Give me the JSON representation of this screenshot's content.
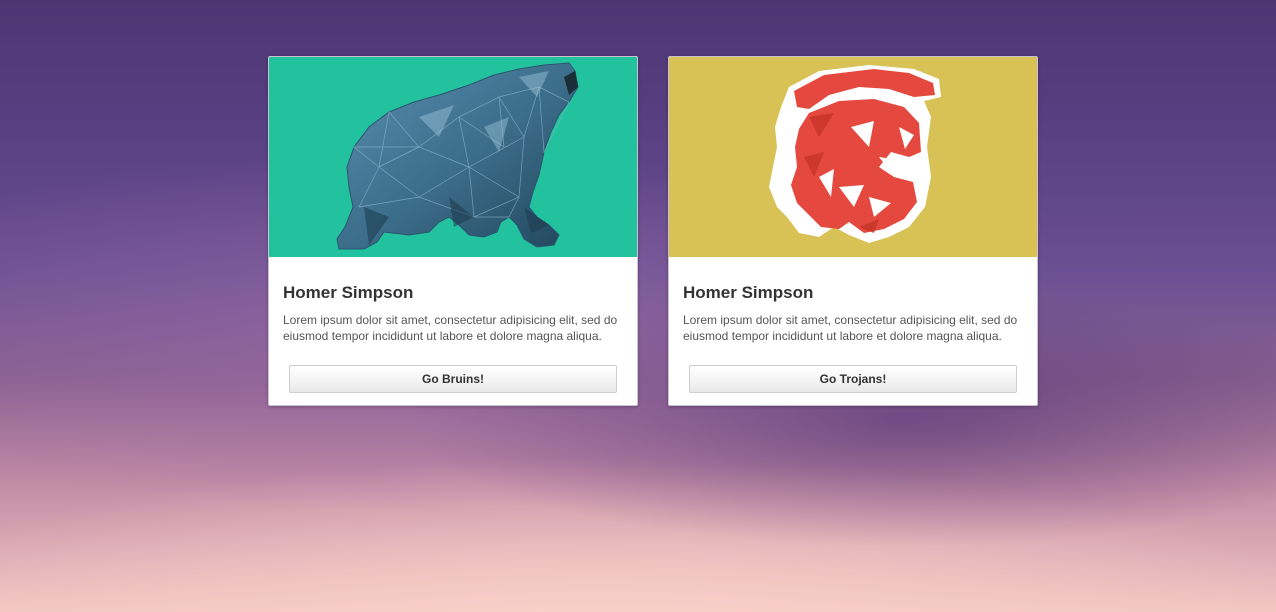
{
  "colors": {
    "bruins_bg": "#22c29e",
    "trojans_bg": "#d8c255",
    "bear_fill": "#3d6f8c",
    "trojan_red": "#e4483e",
    "trojan_white": "#ffffff"
  },
  "cards": [
    {
      "image_icon": "polygon-bear-icon",
      "title": "Homer Simpson",
      "text": "Lorem ipsum dolor sit amet, consectetur adipisicing elit, sed do eiusmod tempor incididunt ut labore et dolore magna aliqua.",
      "button_label": "Go Bruins!"
    },
    {
      "image_icon": "polygon-trojan-helmet-icon",
      "title": "Homer Simpson",
      "text": "Lorem ipsum dolor sit amet, consectetur adipisicing elit, sed do eiusmod tempor incididunt ut labore et dolore magna aliqua.",
      "button_label": "Go Trojans!"
    }
  ]
}
